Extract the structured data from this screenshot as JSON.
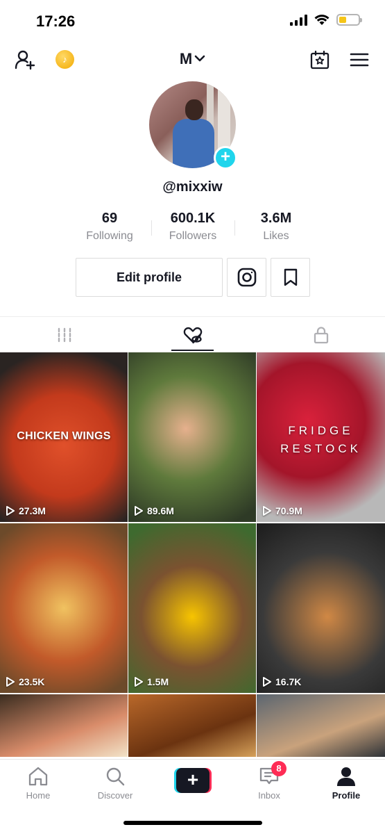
{
  "status": {
    "time": "17:26"
  },
  "header": {
    "account_name": "M",
    "icons": [
      "add-friend-icon",
      "coin-icon",
      "chevron-down-icon",
      "calendar-star-icon",
      "menu-icon"
    ]
  },
  "profile": {
    "username": "@mixxiw",
    "stats": [
      {
        "value": "69",
        "label": "Following"
      },
      {
        "value": "600.1K",
        "label": "Followers"
      },
      {
        "value": "3.6M",
        "label": "Likes"
      }
    ],
    "edit_label": "Edit profile"
  },
  "tabs": [
    "videos-tab",
    "liked-tab",
    "private-tab"
  ],
  "videos": [
    {
      "views": "27.3M",
      "overlay": "CHICKEN WINGS"
    },
    {
      "views": "89.6M",
      "overlay": ""
    },
    {
      "views": "70.9M",
      "overlay": "FRIDGE RESTOCK"
    },
    {
      "views": "23.5K",
      "overlay": ""
    },
    {
      "views": "1.5M",
      "overlay": ""
    },
    {
      "views": "16.7K",
      "overlay": ""
    }
  ],
  "bottom_nav": {
    "items": [
      {
        "label": "Home"
      },
      {
        "label": "Discover"
      },
      {
        "label": "Inbox",
        "badge": "8"
      },
      {
        "label": "Profile"
      }
    ]
  },
  "colors": {
    "accent_cyan": "#20d5ec",
    "accent_red": "#fe2c55",
    "text_dark": "#161823",
    "text_muted": "#8a8b91"
  }
}
